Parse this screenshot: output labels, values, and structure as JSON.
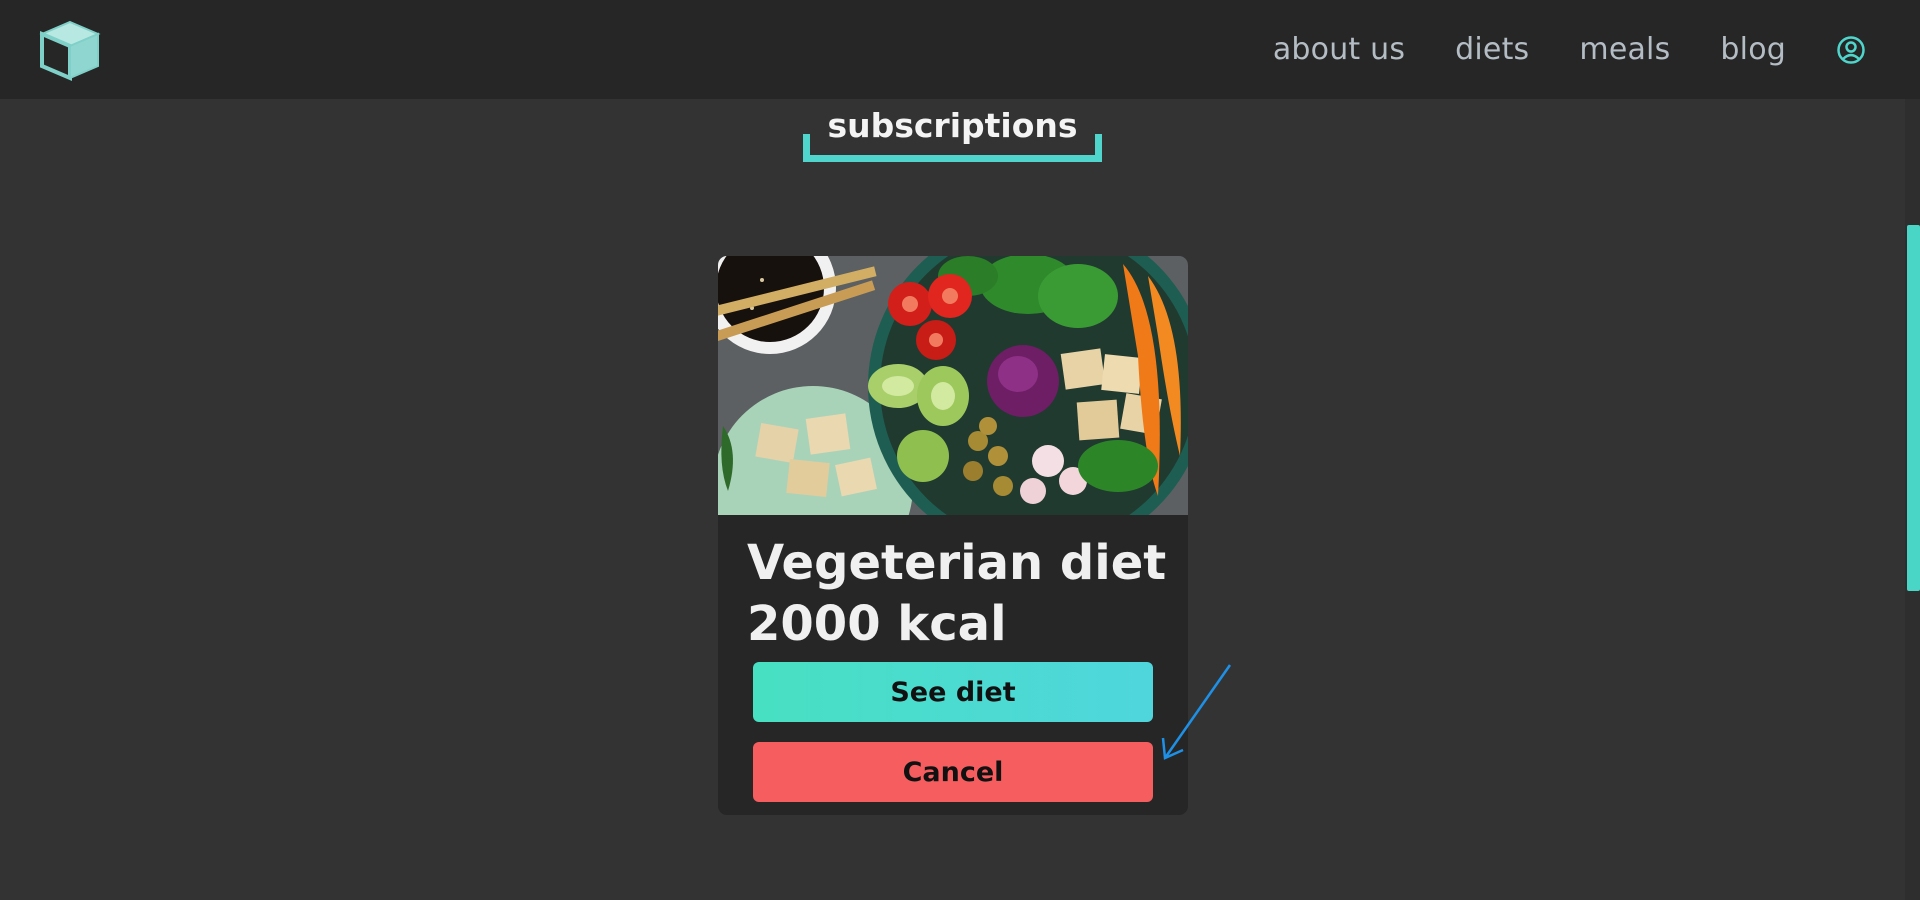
{
  "nav": {
    "logo_icon": "cube-icon",
    "links": [
      "about us",
      "diets",
      "meals",
      "blog"
    ],
    "user_icon": "user-circle-icon"
  },
  "section": {
    "title": "subscriptions"
  },
  "card": {
    "image_icon": "vegetarian-bowl-photo",
    "title_line1": "Vegeterian diet",
    "title_line2": "2000 kcal",
    "see_label": "See diet",
    "cancel_label": "Cancel"
  },
  "colors": {
    "accent": "#4fd5cb",
    "danger": "#f65d5f",
    "background": "#333333",
    "navbar": "#262626"
  }
}
